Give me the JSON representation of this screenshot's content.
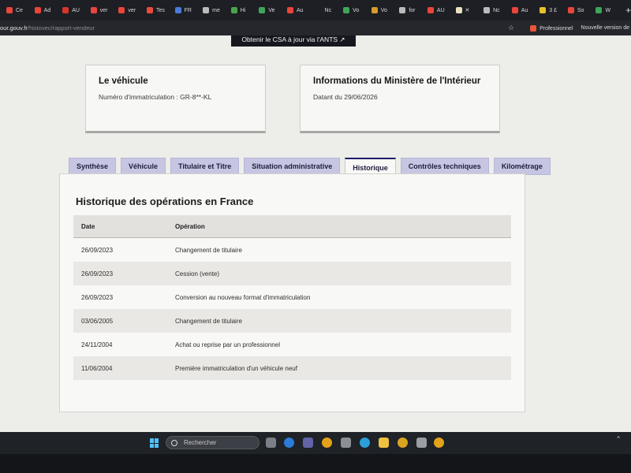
{
  "browser": {
    "tabs": [
      {
        "label": "Ce",
        "color": "#e8453c"
      },
      {
        "label": "Ad",
        "color": "#e8453c"
      },
      {
        "label": "AU",
        "color": "#d8352a"
      },
      {
        "label": "ver",
        "color": "#e8453c"
      },
      {
        "label": "ver",
        "color": "#e8453c"
      },
      {
        "label": "Tes",
        "color": "#e84c3c"
      },
      {
        "label": "FR",
        "color": "#4a7bd8"
      },
      {
        "label": "me",
        "color": "#bbbbbb"
      },
      {
        "label": "Hi",
        "color": "#4aa34a"
      },
      {
        "label": "Ve",
        "color": "#3fa55a"
      },
      {
        "label": "Au",
        "color": "#e8453c"
      },
      {
        "label": "Nc",
        "color": "#1d1f24"
      },
      {
        "label": "Vo",
        "color": "#3fa55a"
      },
      {
        "label": "Vo",
        "color": "#d89a2a"
      },
      {
        "label": "for",
        "color": "#bbbbbb"
      },
      {
        "label": "AU",
        "color": "#e8453c"
      },
      {
        "label": "✕",
        "color": "#e8e0c0"
      },
      {
        "label": "Nc",
        "color": "#bbbbbb"
      },
      {
        "label": "Au",
        "color": "#e8453c"
      },
      {
        "label": "3 £",
        "color": "#e8c02a"
      },
      {
        "label": "So",
        "color": "#e8453c"
      },
      {
        "label": "W",
        "color": "#3fa55a"
      }
    ],
    "new_tab": "+",
    "url_host": "our.gouv.fr",
    "url_path": "/histovec/rapport-vendeur",
    "profile": "Professionnel",
    "new_version": "Nouvelle version de"
  },
  "page": {
    "csa_button": "Obtenir le CSA à jour via l'ANTS ↗",
    "vehicule_card": {
      "title": "Le véhicule",
      "text": "Numéro d'immatriculation : GR-8**-KL"
    },
    "ministere_card": {
      "title": "Informations du Ministère de l'Intérieur",
      "text": "Datant du 29/06/2026"
    },
    "tabs": [
      {
        "label": "Synthèse",
        "active": false
      },
      {
        "label": "Véhicule",
        "active": false
      },
      {
        "label": "Titulaire et Titre",
        "active": false
      },
      {
        "label": "Situation administrative",
        "active": false
      },
      {
        "label": "Historique",
        "active": true
      },
      {
        "label": "Contrôles techniques",
        "active": false
      },
      {
        "label": "Kilométrage",
        "active": false
      }
    ],
    "history": {
      "title": "Historique des opérations en France",
      "headers": {
        "date": "Date",
        "operation": "Opération"
      },
      "rows": [
        {
          "date": "26/09/2023",
          "operation": "Changement de titulaire"
        },
        {
          "date": "26/09/2023",
          "operation": "Cession (vente)"
        },
        {
          "date": "26/09/2023",
          "operation": "Conversion au nouveau format d'immatriculation"
        },
        {
          "date": "03/06/2005",
          "operation": "Changement de titulaire"
        },
        {
          "date": "24/11/2004",
          "operation": "Achat ou reprise par un professionnel"
        },
        {
          "date": "11/06/2004",
          "operation": "Première immatriculation d'un véhicule neuf"
        }
      ]
    }
  },
  "taskbar": {
    "search_placeholder": "Rechercher",
    "tray": "^"
  }
}
